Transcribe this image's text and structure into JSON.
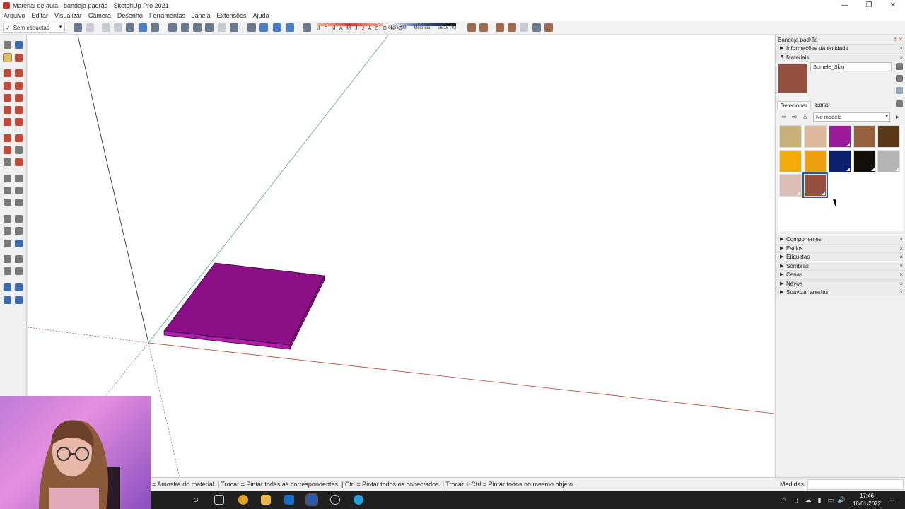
{
  "window": {
    "title": "Material de aula - bandeja padrão - SketchUp Pro 2021",
    "minimize_glyph": "—",
    "maximize_glyph": "❐",
    "close_glyph": "✕"
  },
  "menu": {
    "items": [
      "Arquivo",
      "Editar",
      "Visualizar",
      "Câmera",
      "Desenho",
      "Ferramentas",
      "Janela",
      "Extensões",
      "Ajuda"
    ]
  },
  "toolbar": {
    "tags_check": "✓",
    "tags_label": "Sem etiquetas",
    "months_label": "J F M A M J J A S O N D",
    "time_start": "05:36 AM",
    "time_mid": "Meio-dia",
    "time_end": "06:15 PM"
  },
  "tray": {
    "title": "Bandeja padrão",
    "title_buttons": "⇕ ✕",
    "entity_info_label": "Informações da entidade",
    "materials_label": "Materiais",
    "material_name": "Sumele_Skin",
    "tab_select": "Selecionar",
    "tab_edit": "Editar",
    "library": "No modelo",
    "back_glyph": "⇦",
    "forward_glyph": "⇨",
    "home_glyph": "⌂",
    "details_glyph": "▸",
    "collapsed_arrow": "▶",
    "expanded_arrow": "▼",
    "close_glyph": "×",
    "panels": [
      "Componentes",
      "Estilos",
      "Etiquetas",
      "Sombras",
      "Cenas",
      "Névoa",
      "Suavizar arestas"
    ],
    "swatches": [
      {
        "name": "tile-beige",
        "color": "#c9b078"
      },
      {
        "name": "wood-light",
        "color": "#ddb89a"
      },
      {
        "name": "magenta",
        "color": "#9c1a9c"
      },
      {
        "name": "wood-medium",
        "color": "#95603e"
      },
      {
        "name": "wood-dark",
        "color": "#5a3818"
      },
      {
        "name": "orange-yellow",
        "color": "#f5aa05"
      },
      {
        "name": "orange",
        "color": "#eea010"
      },
      {
        "name": "navy",
        "color": "#0b1f6e"
      },
      {
        "name": "black",
        "color": "#150f0c"
      },
      {
        "name": "gray",
        "color": "#b5b5b5"
      },
      {
        "name": "skin-light",
        "color": "#dcc0b8"
      },
      {
        "name": "sumele-skin",
        "color": "#965040"
      }
    ]
  },
  "status": {
    "hint": "= Amostra do material. | Trocar = Pintar todas as correspondentes. | Ctrl = Pintar todos os conectados. | Trocar + Ctrl = Pintar todos no mesmo objeto.",
    "measures_label": "Medidas"
  },
  "taskbar": {
    "search_glyph": "○",
    "tray_up_glyph": "^",
    "tray_cloud_glyph": "☁",
    "tray_volume_glyph": "🔊",
    "tray_notify_glyph": "▭",
    "time": "17:46",
    "date": "18/01/2022"
  },
  "colors": {
    "model_top": "#8b0f87",
    "model_side": "#b01cae",
    "axis_red": "#b04030",
    "axis_green": "#4a8a4a",
    "axis_blue": "#3a6ab0"
  }
}
